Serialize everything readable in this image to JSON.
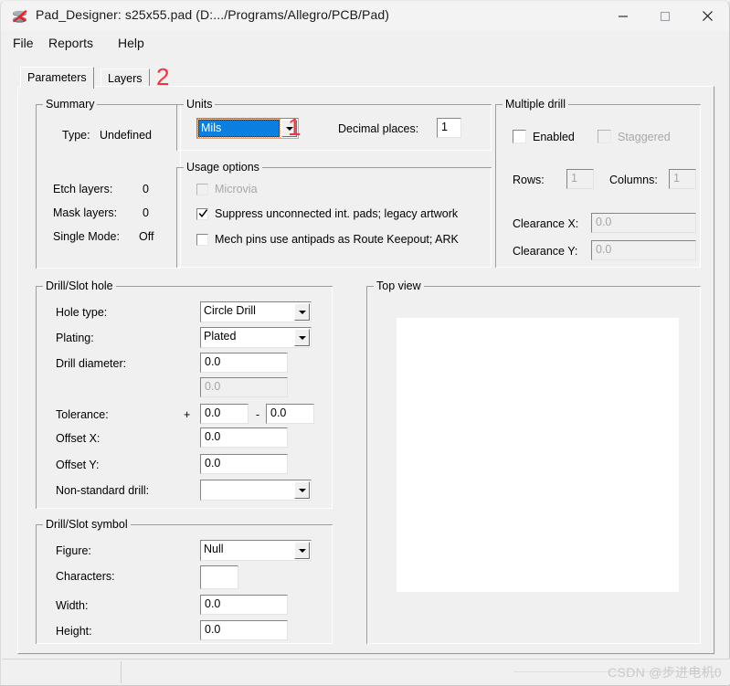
{
  "window": {
    "title": "Pad_Designer: s25x55.pad (D:.../Programs/Allegro/PCB/Pad)",
    "app_icon": "pad-designer-icon",
    "minimize": "—",
    "maximize": "□",
    "close": "✕"
  },
  "menubar": {
    "items": [
      {
        "label": "File"
      },
      {
        "label": "Reports"
      },
      {
        "label": "Help"
      }
    ]
  },
  "tabs": [
    {
      "label": "Parameters",
      "active": true
    },
    {
      "label": "Layers",
      "active": false
    }
  ],
  "annotations": [
    {
      "label": "1",
      "color": "#f4333d"
    },
    {
      "label": "2",
      "color": "#f4333d"
    }
  ],
  "summary": {
    "title": "Summary",
    "rows": [
      {
        "label": "Type:",
        "value": "Undefined"
      },
      {
        "label": "Etch layers:",
        "value": "0"
      },
      {
        "label": "Mask layers:",
        "value": "0"
      },
      {
        "label": "Single Mode:",
        "value": "Off"
      }
    ]
  },
  "units": {
    "title": "Units",
    "value": "Mils",
    "decimal_places_label": "Decimal places:",
    "decimal_places_value": "1"
  },
  "usage_options": {
    "title": "Usage options",
    "items": [
      {
        "label": "Microvia",
        "checked": false,
        "disabled": true
      },
      {
        "label": "Suppress unconnected int. pads; legacy artwork",
        "checked": true,
        "disabled": false
      },
      {
        "label": "Mech pins use antipads as Route Keepout; ARK",
        "checked": false,
        "disabled": false
      }
    ]
  },
  "multiple_drill": {
    "title": "Multiple drill",
    "enabled_label": "Enabled",
    "enabled_checked": false,
    "staggered_label": "Staggered",
    "staggered_checked": false,
    "staggered_disabled": true,
    "rows_label": "Rows:",
    "rows_value": "1",
    "columns_label": "Columns:",
    "columns_value": "1",
    "clearance_x_label": "Clearance X:",
    "clearance_x_value": "0.0",
    "clearance_y_label": "Clearance Y:",
    "clearance_y_value": "0.0"
  },
  "drill_slot_hole": {
    "title": "Drill/Slot hole",
    "hole_type_label": "Hole type:",
    "hole_type_value": "Circle Drill",
    "plating_label": "Plating:",
    "plating_value": "Plated",
    "drill_diameter_label": "Drill diameter:",
    "drill_diameter_value": "0.0",
    "drill_diameter_second_value": "0.0",
    "tolerance_label": "Tolerance:",
    "tolerance_plus_sign": "+",
    "tolerance_plus_value": "0.0",
    "tolerance_minus_sign": "-",
    "tolerance_minus_value": "0.0",
    "offset_x_label": "Offset X:",
    "offset_x_value": "0.0",
    "offset_y_label": "Offset Y:",
    "offset_y_value": "0.0",
    "non_standard_drill_label": "Non-standard drill:",
    "non_standard_drill_value": ""
  },
  "drill_slot_symbol": {
    "title": "Drill/Slot symbol",
    "figure_label": "Figure:",
    "figure_value": "Null",
    "characters_label": "Characters:",
    "characters_value": "",
    "width_label": "Width:",
    "width_value": "0.0",
    "height_label": "Height:",
    "height_value": "0.0"
  },
  "top_view": {
    "title": "Top view"
  },
  "statusbar": {
    "watermark": "CSDN @步进电机0"
  }
}
